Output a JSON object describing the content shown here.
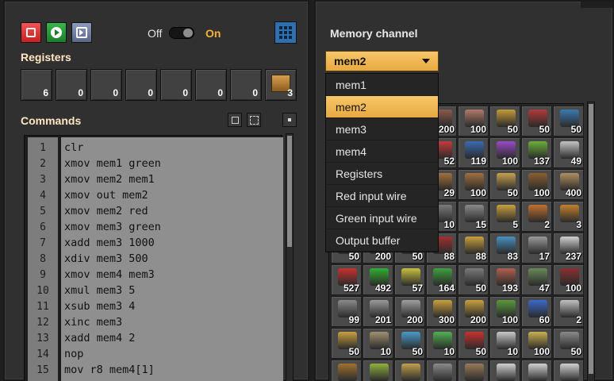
{
  "controls": {
    "toggle_off_label": "Off",
    "toggle_on_label": "On",
    "state": "On",
    "colors": {
      "stop": "#e23a3a",
      "run": "#2a9a3c",
      "accent": "#f5b235"
    }
  },
  "registers": {
    "title": "Registers",
    "values": [
      "6",
      "0",
      "0",
      "0",
      "0",
      "0",
      "0",
      "3"
    ]
  },
  "commands": {
    "title": "Commands",
    "lines": [
      {
        "num": "1",
        "code": "clr"
      },
      {
        "num": "2",
        "code": "xmov mem1 green"
      },
      {
        "num": "3",
        "code": "xmov mem2 mem1"
      },
      {
        "num": "4",
        "code": "xmov out mem2"
      },
      {
        "num": "5",
        "code": "xmov mem2 red"
      },
      {
        "num": "6",
        "code": "xmov mem3 green"
      },
      {
        "num": "7",
        "code": "xadd mem3 1000"
      },
      {
        "num": "8",
        "code": "xdiv mem3 500"
      },
      {
        "num": "9",
        "code": "xmov mem4 mem3"
      },
      {
        "num": "10",
        "code": "xmul mem3 5"
      },
      {
        "num": "11",
        "code": "xsub mem3 4"
      },
      {
        "num": "12",
        "code": "xinc mem3"
      },
      {
        "num": "13",
        "code": "xadd mem4 2"
      },
      {
        "num": "14",
        "code": "nop"
      },
      {
        "num": "15",
        "code": "mov r8 mem4[1]"
      }
    ]
  },
  "memory": {
    "title": "Memory channel",
    "selected": "mem2",
    "options": [
      "mem1",
      "mem2",
      "mem3",
      "mem4",
      "Registers",
      "Red input wire",
      "Green input wire",
      "Output buffer"
    ]
  },
  "signals": {
    "rows": [
      [
        {
          "count": "",
          "color": "#6a6a6a",
          "icon": "hidden-item-icon"
        },
        {
          "count": "",
          "color": "#6a6a6a",
          "icon": "hidden-item-icon"
        },
        {
          "count": "",
          "color": "#6a6a6a",
          "icon": "hidden-item-icon"
        },
        {
          "count": "200",
          "color": "#8b5a4a",
          "icon": "item-icon"
        },
        {
          "count": "100",
          "color": "#b27a6a",
          "icon": "item-icon"
        },
        {
          "count": "50",
          "color": "#c39a3a",
          "icon": "item-icon"
        },
        {
          "count": "50",
          "color": "#b03a3a",
          "icon": "item-icon"
        },
        {
          "count": "50",
          "color": "#3a7ab0",
          "icon": "item-icon"
        }
      ],
      [
        {
          "count": "",
          "color": "#6a6a6a",
          "icon": "hidden-item-icon"
        },
        {
          "count": "",
          "color": "#6a6a6a",
          "icon": "hidden-item-icon"
        },
        {
          "count": "",
          "color": "#6a6a6a",
          "icon": "hidden-item-icon"
        },
        {
          "count": "52",
          "color": "#c43a3a",
          "icon": "inserter-icon"
        },
        {
          "count": "119",
          "color": "#3a6ab0",
          "icon": "inserter-icon"
        },
        {
          "count": "100",
          "color": "#9a4ac4",
          "icon": "inserter-icon"
        },
        {
          "count": "137",
          "color": "#6ab03a",
          "icon": "inserter-icon"
        },
        {
          "count": "49",
          "color": "#c4c4c4",
          "icon": "inserter-icon"
        }
      ],
      [
        {
          "count": "",
          "color": "#6a6a6a",
          "icon": "hidden-item-icon"
        },
        {
          "count": "",
          "color": "#6a6a6a",
          "icon": "hidden-item-icon"
        },
        {
          "count": "",
          "color": "#6a6a6a",
          "icon": "hidden-item-icon"
        },
        {
          "count": "29",
          "color": "#a07040",
          "icon": "pipe-icon"
        },
        {
          "count": "100",
          "color": "#a07040",
          "icon": "pipe-icon"
        },
        {
          "count": "50",
          "color": "#c8a050",
          "icon": "pump-icon"
        },
        {
          "count": "100",
          "color": "#8a6030",
          "icon": "rail-icon"
        },
        {
          "count": "400",
          "color": "#b09060",
          "icon": "rail-icon"
        }
      ],
      [
        {
          "count": "",
          "color": "#6a6a6a",
          "icon": "hidden-item-icon"
        },
        {
          "count": "",
          "color": "#6a6a6a",
          "icon": "hidden-item-icon"
        },
        {
          "count": "",
          "color": "#6a6a6a",
          "icon": "hidden-item-icon"
        },
        {
          "count": "10",
          "color": "#7a7a7a",
          "icon": "item-icon"
        },
        {
          "count": "15",
          "color": "#8a8a8a",
          "icon": "item-icon"
        },
        {
          "count": "5",
          "color": "#c8a040",
          "icon": "item-icon"
        },
        {
          "count": "2",
          "color": "#c07030",
          "icon": "vehicle-icon"
        },
        {
          "count": "3",
          "color": "#c08030",
          "icon": "vehicle-icon"
        }
      ],
      [
        {
          "count": "50",
          "color": "#5a5a5a",
          "icon": "item-icon"
        },
        {
          "count": "200",
          "color": "#6a6a6a",
          "icon": "item-icon"
        },
        {
          "count": "50",
          "color": "#5a6a7a",
          "icon": "item-icon"
        },
        {
          "count": "88",
          "color": "#a03030",
          "icon": "item-icon"
        },
        {
          "count": "88",
          "color": "#c8a040",
          "icon": "item-icon"
        },
        {
          "count": "83",
          "color": "#4a90c0",
          "icon": "item-icon"
        },
        {
          "count": "17",
          "color": "#9a9a9a",
          "icon": "item-icon"
        },
        {
          "count": "237",
          "color": "#d0d0d0",
          "icon": "item-icon"
        }
      ],
      [
        {
          "count": "527",
          "color": "#c83030",
          "icon": "red-wire-icon"
        },
        {
          "count": "492",
          "color": "#30b030",
          "icon": "green-wire-icon"
        },
        {
          "count": "57",
          "color": "#c8c040",
          "icon": "arithmetic-combinator-icon"
        },
        {
          "count": "164",
          "color": "#40a040",
          "icon": "decider-combinator-icon"
        },
        {
          "count": "50",
          "color": "#7a7a7a",
          "icon": "constant-combinator-icon"
        },
        {
          "count": "193",
          "color": "#b06050",
          "icon": "item-icon"
        },
        {
          "count": "47",
          "color": "#6a8a5a",
          "icon": "item-icon"
        },
        {
          "count": "100",
          "color": "#8a3030",
          "icon": "item-icon"
        }
      ],
      [
        {
          "count": "99",
          "color": "#8a8a8a",
          "icon": "item-icon"
        },
        {
          "count": "201",
          "color": "#9a9a9a",
          "icon": "stone-brick-icon"
        },
        {
          "count": "200",
          "color": "#a0a0a0",
          "icon": "concrete-icon"
        },
        {
          "count": "300",
          "color": "#c8a040",
          "icon": "hazard-concrete-icon"
        },
        {
          "count": "200",
          "color": "#c8a040",
          "icon": "hazard-concrete-icon"
        },
        {
          "count": "100",
          "color": "#5a9a3a",
          "icon": "landfill-icon"
        },
        {
          "count": "60",
          "color": "#3a6ac8",
          "icon": "cliff-explosives-icon"
        },
        {
          "count": "2",
          "color": "#c0c0c0",
          "icon": "repair-pack-icon"
        }
      ],
      [
        {
          "count": "50",
          "color": "#c8a040",
          "icon": "item-icon"
        },
        {
          "count": "10",
          "color": "#a09070",
          "icon": "item-icon"
        },
        {
          "count": "50",
          "color": "#4a9ac8",
          "icon": "item-icon"
        },
        {
          "count": "10",
          "color": "#50b050",
          "icon": "item-icon"
        },
        {
          "count": "50",
          "color": "#c83030",
          "icon": "item-icon"
        },
        {
          "count": "10",
          "color": "#c8c8c8",
          "icon": "item-icon"
        },
        {
          "count": "100",
          "color": "#c8b050",
          "icon": "item-icon"
        },
        {
          "count": "50",
          "color": "#8a8a8a",
          "icon": "item-icon"
        }
      ],
      [
        {
          "count": "",
          "color": "#a07030",
          "icon": "item-icon"
        },
        {
          "count": "",
          "color": "#90b040",
          "icon": "item-icon"
        },
        {
          "count": "",
          "color": "#c0a050",
          "icon": "item-icon"
        },
        {
          "count": "",
          "color": "#8a8a8a",
          "icon": "item-icon"
        },
        {
          "count": "",
          "color": "#9a7a5a",
          "icon": "item-icon"
        },
        {
          "count": "",
          "color": "#d0d0d0",
          "icon": "item-icon"
        },
        {
          "count": "",
          "color": "#d0d0d0",
          "icon": "item-icon"
        },
        {
          "count": "",
          "color": "#d0d0d0",
          "icon": "item-icon"
        }
      ]
    ]
  }
}
